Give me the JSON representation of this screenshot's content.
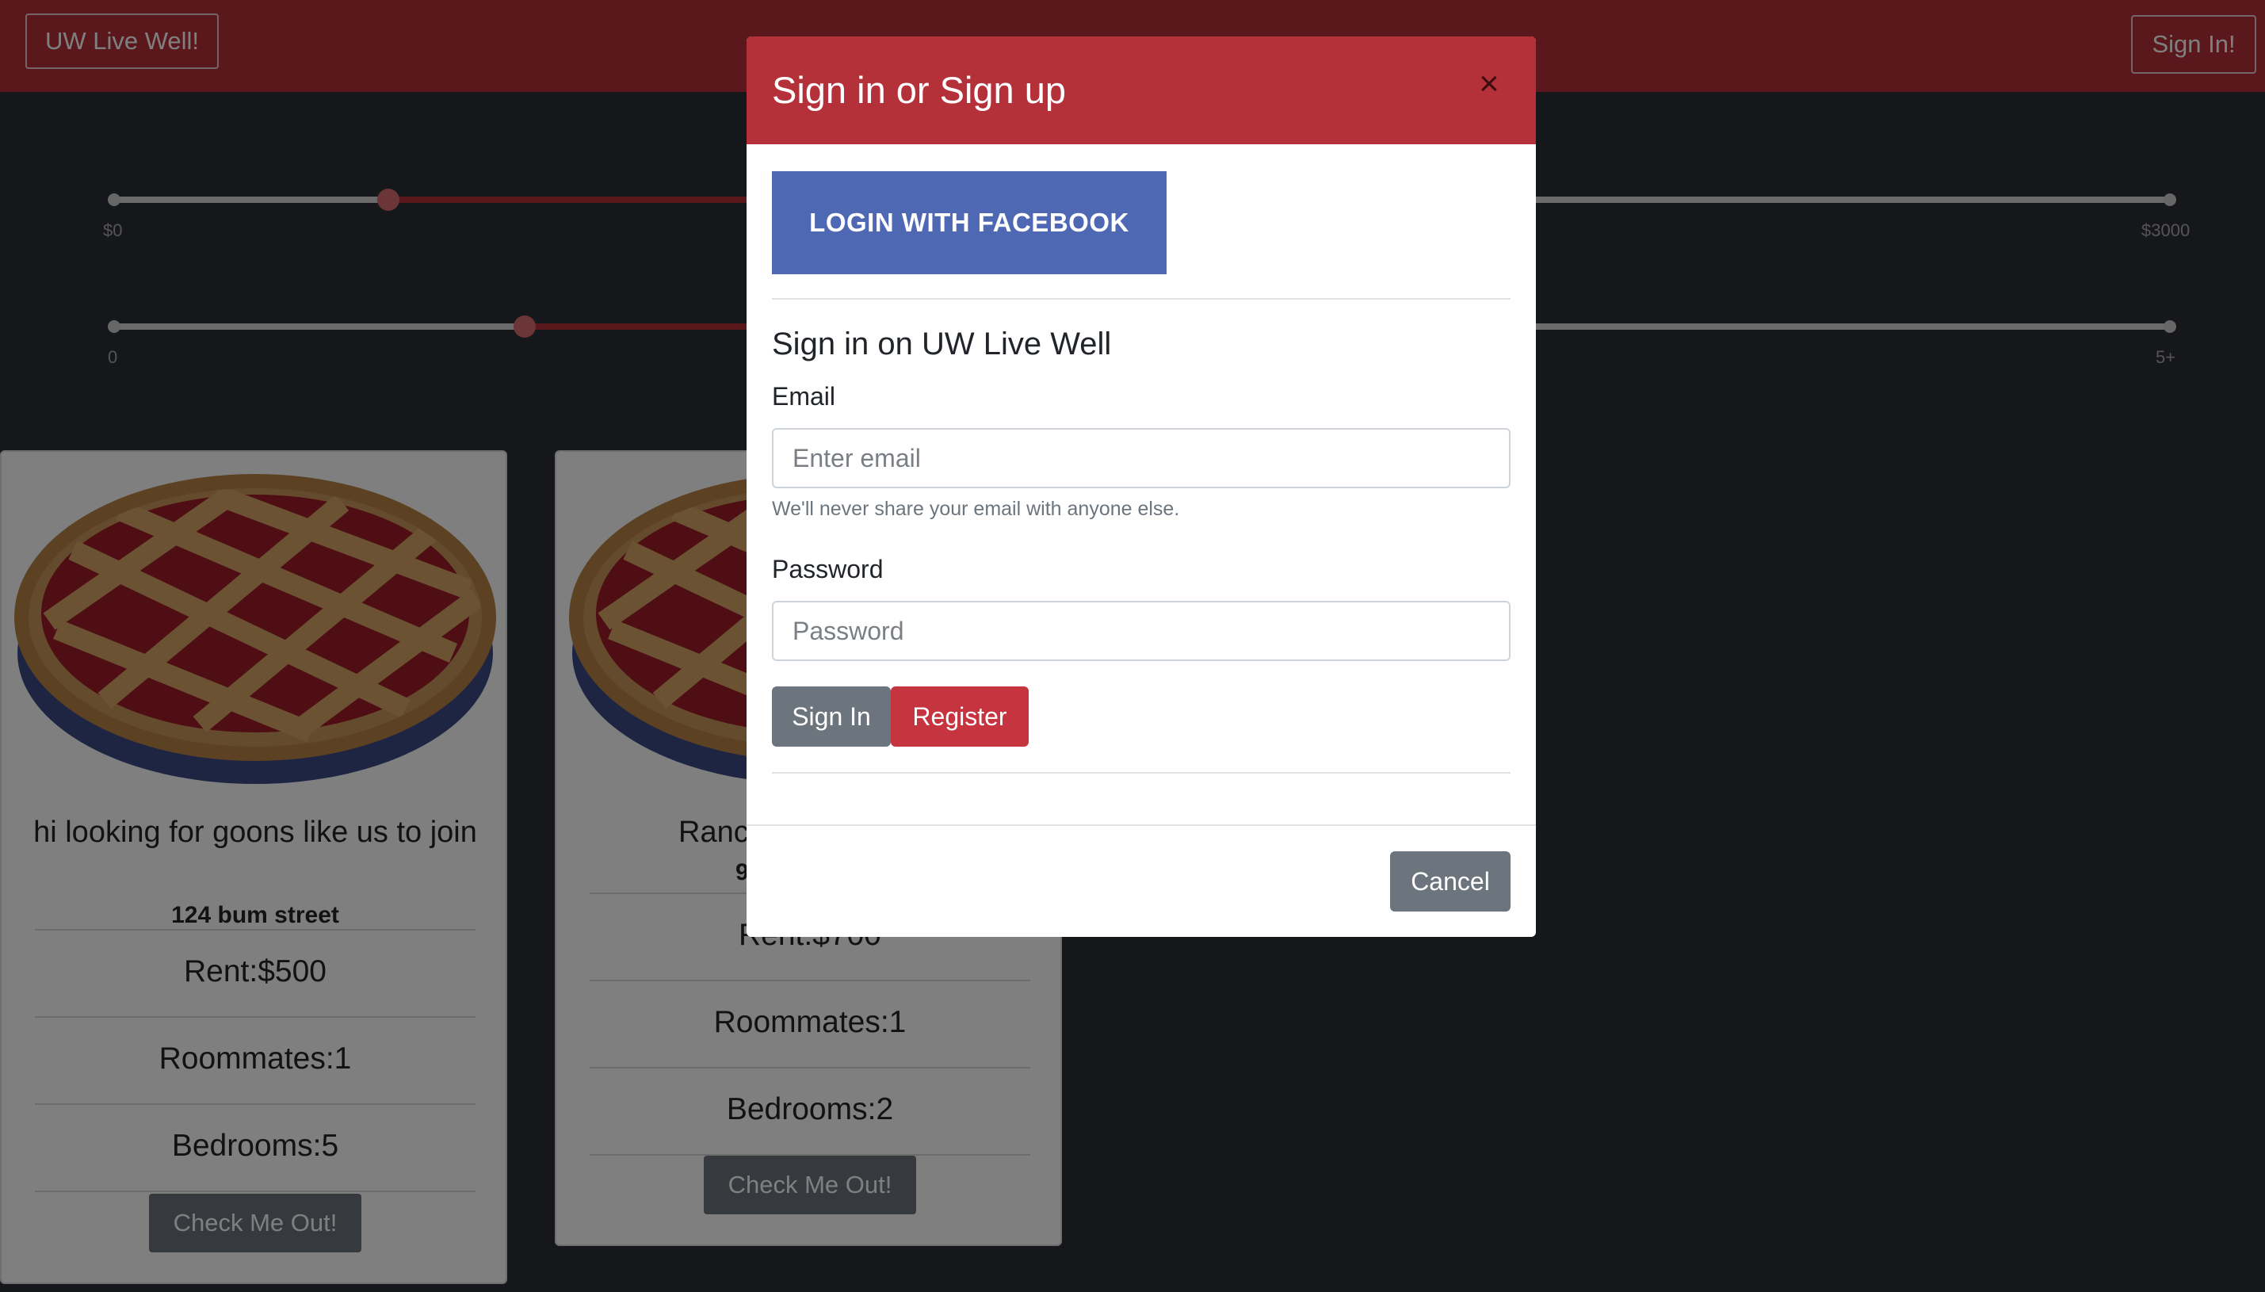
{
  "navbar": {
    "brand": "UW Live Well!",
    "signin_label": "Sign In!"
  },
  "filters": {
    "rent": {
      "min_label": "$0",
      "max_label": "$3000"
    },
    "roommates": {
      "min_label": "0",
      "max_label": "5+"
    }
  },
  "listings": [
    {
      "title": "hi looking for goons like us to join",
      "address": "124 bum street",
      "rent": "Rent:$500",
      "roommates": "Roommates:1",
      "bedrooms": "Bedrooms:5",
      "button": "Check Me Out!"
    },
    {
      "title": "Ranc",
      "address": "9",
      "rent": "Rent:$700",
      "roommates": "Roommates:1",
      "bedrooms": "Bedrooms:2",
      "button": "Check Me Out!"
    }
  ],
  "modal": {
    "title": "Sign in or Sign up",
    "close_icon": "×",
    "facebook_label": "LOGIN WITH FACEBOOK",
    "subheading": "Sign in on UW Live Well",
    "email_label": "Email",
    "email_placeholder": "Enter email",
    "email_help": "We'll never share your email with anyone else.",
    "password_label": "Password",
    "password_placeholder": "Password",
    "signin_label": "Sign In",
    "register_label": "Register",
    "cancel_label": "Cancel"
  },
  "colors": {
    "brand_red": "#b5313a",
    "facebook_blue": "#4e68b3",
    "secondary_gray": "#6c757d"
  }
}
